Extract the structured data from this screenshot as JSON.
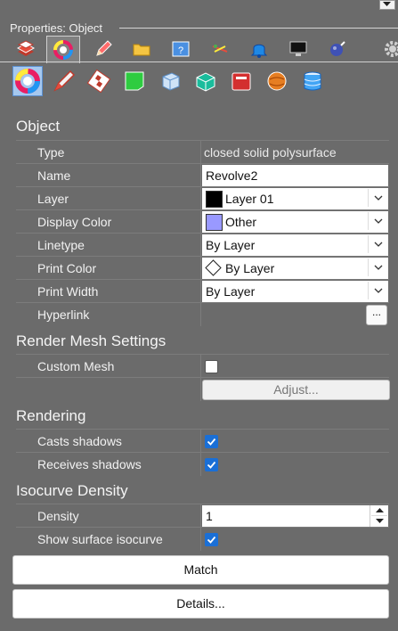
{
  "panel": {
    "title": "Properties: Object"
  },
  "tabs": [
    {
      "icon": "layer-stack-icon"
    },
    {
      "icon": "color-wheel-icon"
    },
    {
      "icon": "pencil-icon"
    },
    {
      "icon": "folder-icon"
    },
    {
      "icon": "help-window-icon"
    },
    {
      "icon": "tools-icon"
    },
    {
      "icon": "bell-icon"
    },
    {
      "icon": "monitor-icon"
    },
    {
      "icon": "sphere-light-icon"
    },
    {
      "icon": "gear-icon"
    }
  ],
  "subtabs": [
    {
      "icon": "object-color-wheel-icon"
    },
    {
      "icon": "paint-brush-icon"
    },
    {
      "icon": "checker-tube-icon"
    },
    {
      "icon": "green-material-icon"
    },
    {
      "icon": "glass-cube-icon"
    },
    {
      "icon": "teal-cube-icon"
    },
    {
      "icon": "red-box-icon"
    },
    {
      "icon": "orange-ball-icon"
    },
    {
      "icon": "database-icon"
    }
  ],
  "sections": {
    "object": "Object",
    "render_mesh": "Render Mesh Settings",
    "rendering": "Rendering",
    "isocurve": "Isocurve Density"
  },
  "object": {
    "type_label": "Type",
    "type_value": "closed solid polysurface",
    "name_label": "Name",
    "name_value": "Revolve2",
    "layer_label": "Layer",
    "layer_value": "Layer 01",
    "layer_color": "#000000",
    "display_color_label": "Display Color",
    "display_color_value": "Other",
    "display_color_swatch": "#9999ff",
    "linetype_label": "Linetype",
    "linetype_value": "By Layer",
    "print_color_label": "Print Color",
    "print_color_value": "By Layer",
    "print_width_label": "Print Width",
    "print_width_value": "By Layer",
    "hyperlink_label": "Hyperlink",
    "hyperlink_button": "..."
  },
  "render_mesh": {
    "custom_mesh_label": "Custom Mesh",
    "custom_mesh_checked": false,
    "adjust_button": "Adjust..."
  },
  "rendering": {
    "casts_shadows_label": "Casts shadows",
    "casts_shadows_checked": true,
    "receives_shadows_label": "Receives shadows",
    "receives_shadows_checked": true
  },
  "isocurve": {
    "density_label": "Density",
    "density_value": "1",
    "show_isocurve_label": "Show surface isocurve",
    "show_isocurve_checked": true
  },
  "buttons": {
    "match": "Match",
    "details": "Details..."
  },
  "colors": {
    "panel_bg": "#6b6b6b",
    "checkbox_accent": "#1a6fd6",
    "selected_icon_bg": "#a6c8ef"
  }
}
